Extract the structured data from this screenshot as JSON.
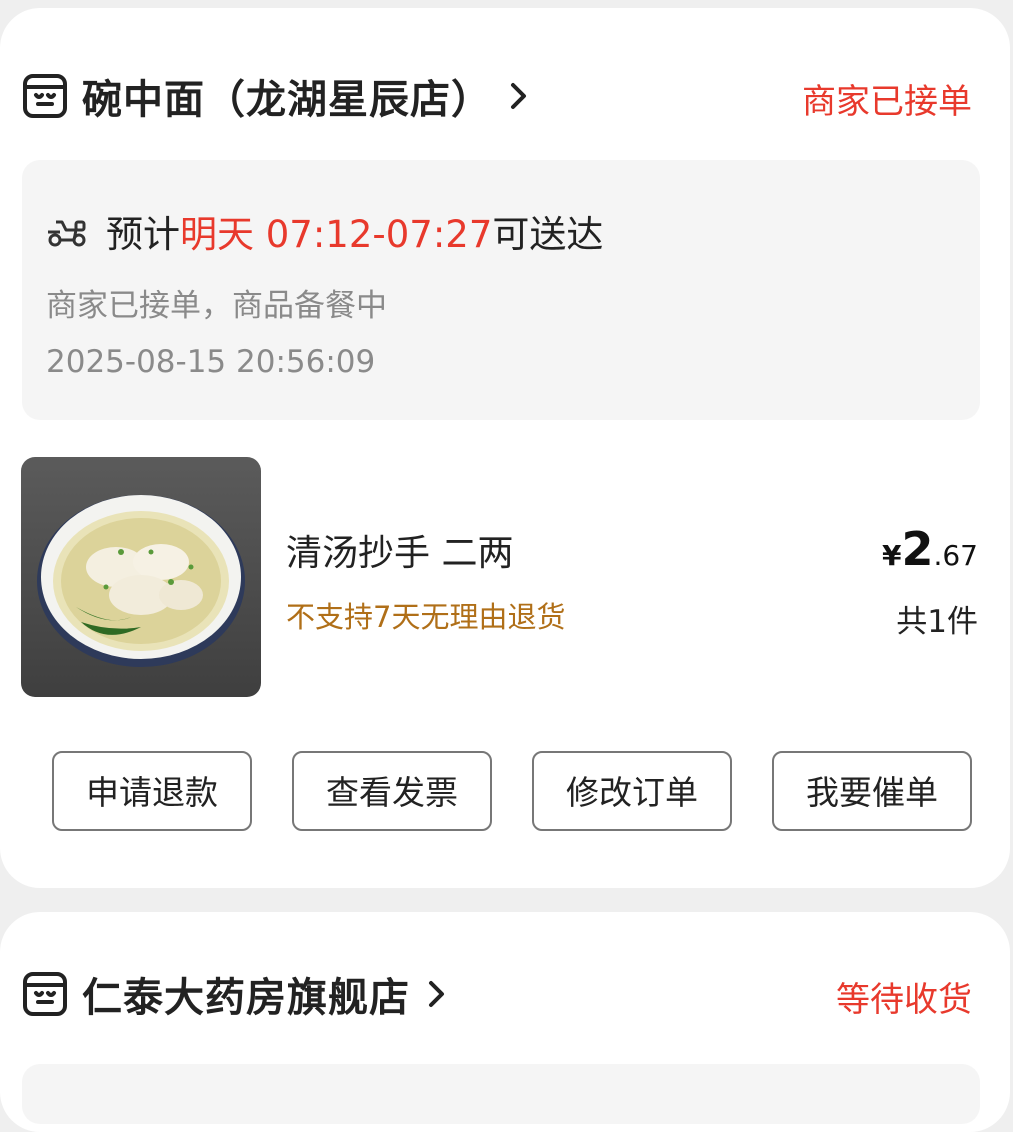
{
  "orders": [
    {
      "store_name": "碗中面（龙湖星辰店）",
      "status": "商家已接单",
      "eta_prefix": "预计",
      "eta_time": "明天 07:12-07:27",
      "eta_suffix": "可送达",
      "sub_status": "商家已接单，商品备餐中",
      "timestamp": "2025-08-15 20:56:09",
      "product": {
        "name": "清汤抄手 二两",
        "note": "不支持7天无理由退货",
        "price_currency": "¥",
        "price_int": "2",
        "price_dec": ".67",
        "quantity": "共1件"
      },
      "buttons": [
        "申请退款",
        "查看发票",
        "修改订单",
        "我要催单"
      ]
    },
    {
      "store_name": "仁泰大药房旗舰店",
      "status": "等待收货"
    }
  ],
  "colors": {
    "accent_red": "#e8392c",
    "note_orange": "#b06f18",
    "muted_gray": "#8a8a8a"
  },
  "icons": [
    "store-icon",
    "chevron-right-icon",
    "scooter-icon"
  ]
}
